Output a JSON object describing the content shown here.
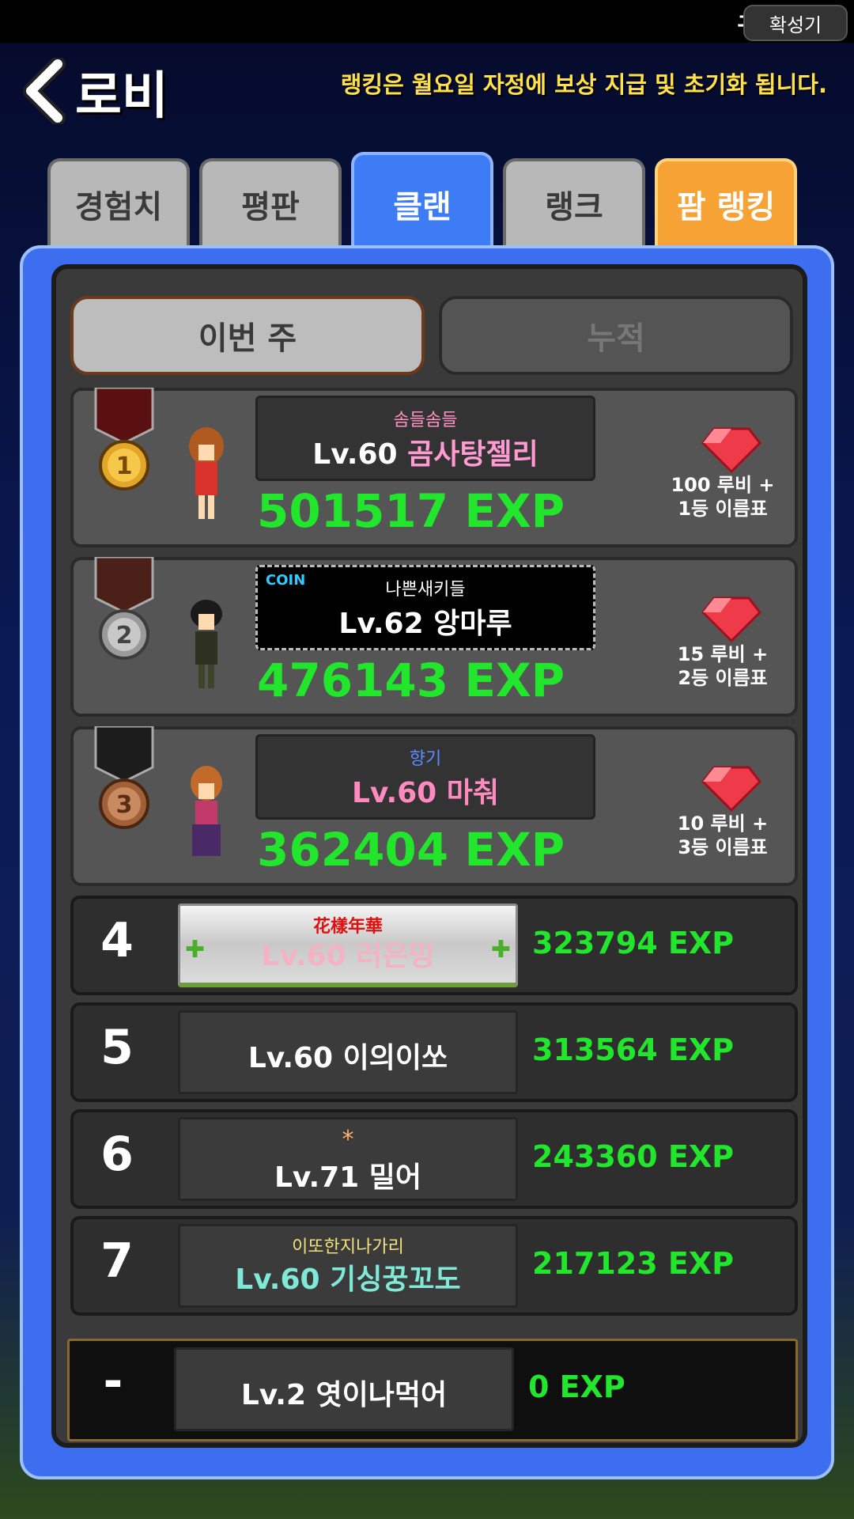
{
  "status": {
    "char": "귀",
    "magnify_label": "확성기"
  },
  "header": {
    "title": "로비",
    "notice": "랭킹은 월요일 자정에 보상 지급 및 초기화 됩니다."
  },
  "tabs": [
    {
      "label": "경험치"
    },
    {
      "label": "평판"
    },
    {
      "label": "클랜"
    },
    {
      "label": "랭크"
    },
    {
      "label": "팜 랭킹"
    }
  ],
  "subtabs": {
    "this_week": "이번 주",
    "cumulative": "누적"
  },
  "top3": [
    {
      "rank": "1",
      "clan": "솜들솜들",
      "clan_color": "#ff8fc7",
      "lv": "Lv.60",
      "name": "곰사탕젤리",
      "name_color": "#ff9ad3",
      "exp": "501517 EXP",
      "reward_line1": "100 루비 +",
      "reward_line2": "1등 이름표"
    },
    {
      "rank": "2",
      "coin_tag": "COIN",
      "clan": "나쁜새키들",
      "clan_color": "#ffffff",
      "lv": "Lv.62",
      "name": "앙마루",
      "name_color": "#ffffff",
      "exp": "476143 EXP",
      "reward_line1": "15 루비 +",
      "reward_line2": "2등 이름표"
    },
    {
      "rank": "3",
      "clan": "향기",
      "clan_color": "#5a8cff",
      "lv": "Lv.60",
      "name": "마춰",
      "name_color": "#ff8ac0",
      "exp": "362404 EXP",
      "reward_line1": "10 루비 +",
      "reward_line2": "3등 이름표"
    }
  ],
  "rows": [
    {
      "rank": "4",
      "clan": "花樣年華",
      "clan_color": "#e01010",
      "name": "Lv.60 러은밍",
      "name_color": "#f3b3c2",
      "exp": "323794 EXP"
    },
    {
      "rank": "5",
      "clan": "",
      "clan_color": "#ffffff",
      "name": "Lv.60 이의이쏘",
      "name_color": "#ffffff",
      "exp": "313564 EXP"
    },
    {
      "rank": "6",
      "clan": "*",
      "clan_color": "#ffb070",
      "name": "Lv.71 밀어",
      "name_color": "#ffffff",
      "exp": "243360 EXP"
    },
    {
      "rank": "7",
      "clan": "이또한지나가리",
      "clan_color": "#f2e27a",
      "name": "Lv.60 기싱꿍꼬도",
      "name_color": "#7fe8d6",
      "exp": "217123 EXP"
    }
  ],
  "my_rank": {
    "rank": "-",
    "name": "Lv.2 엿이나먹어",
    "exp": "0 EXP"
  }
}
